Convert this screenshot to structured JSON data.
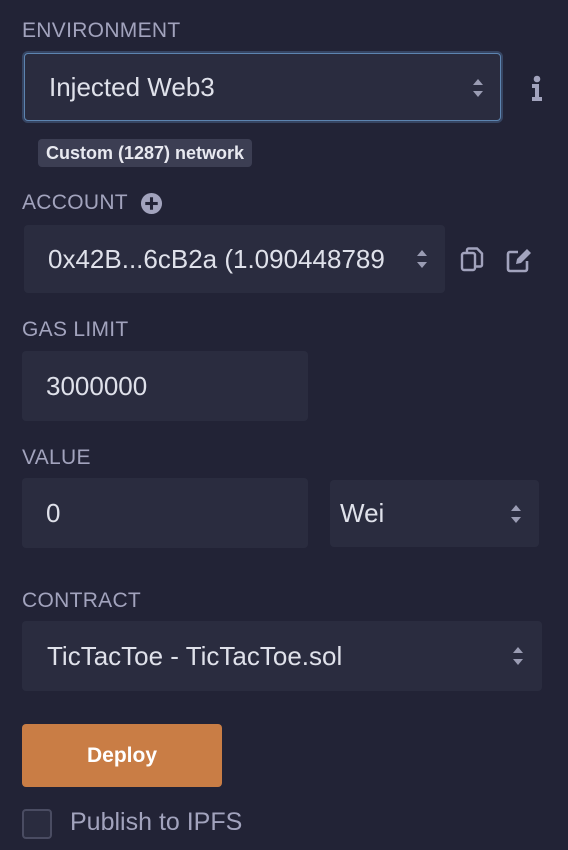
{
  "environment": {
    "label": "ENVIRONMENT",
    "selected": "Injected Web3",
    "network_badge": "Custom (1287) network",
    "info_icon": "info-icon"
  },
  "account": {
    "label": "ACCOUNT",
    "add_icon": "plus-circle-icon",
    "selected": "0x42B...6cB2a (1.090448789",
    "copy_icon": "copy-icon",
    "edit_icon": "edit-icon"
  },
  "gas_limit": {
    "label": "GAS LIMIT",
    "value": "3000000"
  },
  "value": {
    "label": "VALUE",
    "amount": "0",
    "unit": "Wei"
  },
  "contract": {
    "label": "CONTRACT",
    "selected": "TicTacToe - TicTacToe.sol"
  },
  "deploy": {
    "label": "Deploy"
  },
  "publish": {
    "label": "Publish to IPFS",
    "checked": false
  },
  "colors": {
    "background": "#222336",
    "field": "#2a2c3f",
    "label": "#a2a3bd",
    "deploy_button": "#c97d45",
    "focus_border": "#5d84b0"
  }
}
